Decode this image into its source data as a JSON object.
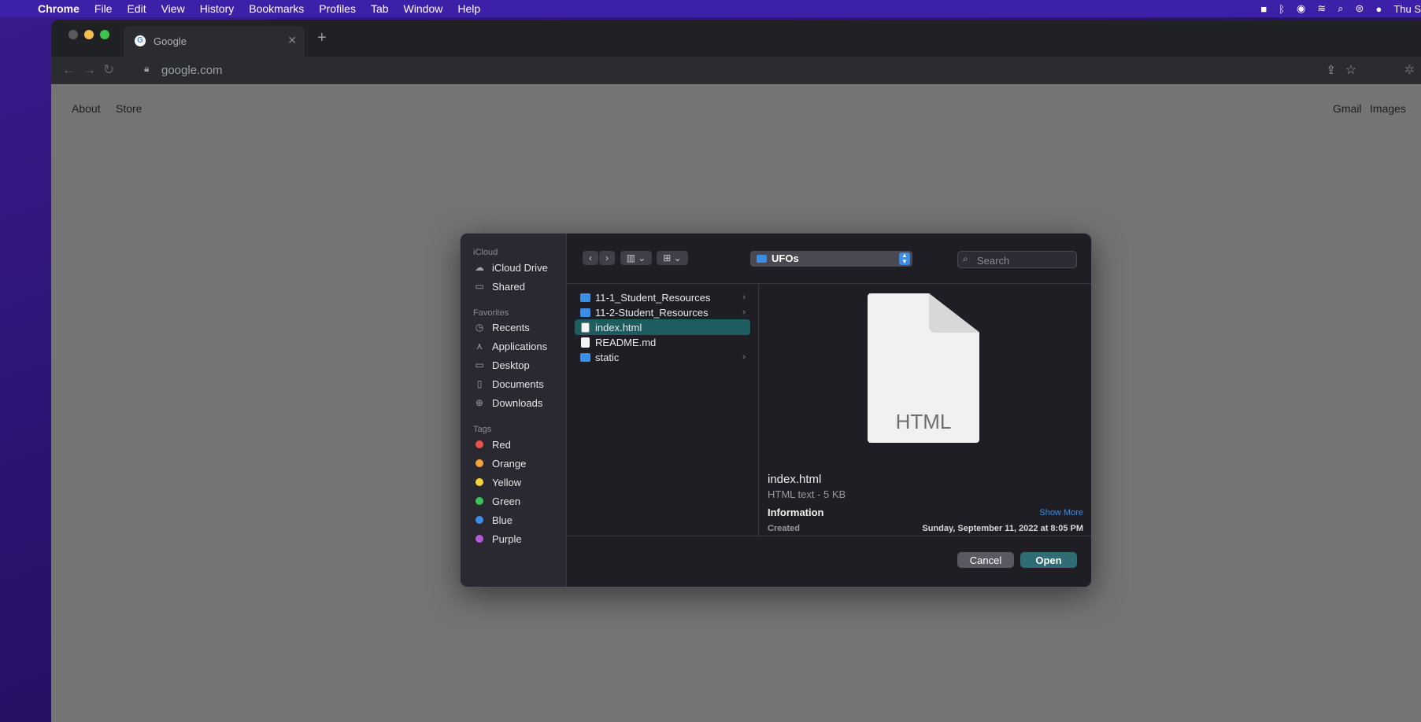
{
  "menubar": {
    "items": [
      "Chrome",
      "File",
      "Edit",
      "View",
      "History",
      "Bookmarks",
      "Profiles",
      "Tab",
      "Window",
      "Help"
    ],
    "clock": "Thu S"
  },
  "browser": {
    "tab_title": "Google",
    "url": "google.com"
  },
  "page": {
    "links_left": [
      "About",
      "Store"
    ],
    "links_right": [
      "Gmail",
      "Images"
    ]
  },
  "dialog": {
    "sidebar": {
      "icloud_head": "iCloud",
      "icloud": [
        "iCloud Drive",
        "Shared"
      ],
      "favorites_head": "Favorites",
      "favorites": [
        "Recents",
        "Applications",
        "Desktop",
        "Documents",
        "Downloads"
      ],
      "tags_head": "Tags",
      "tags": [
        {
          "label": "Red",
          "color": "#e5534b"
        },
        {
          "label": "Orange",
          "color": "#f2a33a"
        },
        {
          "label": "Yellow",
          "color": "#f5d33a"
        },
        {
          "label": "Green",
          "color": "#39c45a"
        },
        {
          "label": "Blue",
          "color": "#3a8ee6"
        },
        {
          "label": "Purple",
          "color": "#b45ad8"
        }
      ]
    },
    "current_folder": "UFOs",
    "search_placeholder": "Search",
    "files": [
      {
        "name": "11-1_Student_Resources",
        "kind": "folder"
      },
      {
        "name": "11-2-Student_Resources",
        "kind": "folder"
      },
      {
        "name": "index.html",
        "kind": "html",
        "selected": true
      },
      {
        "name": "README.md",
        "kind": "doc"
      },
      {
        "name": "static",
        "kind": "folder"
      }
    ],
    "preview": {
      "icon_label": "HTML",
      "name": "index.html",
      "kind": "HTML text - 5 KB",
      "info_head": "Information",
      "show_more": "Show More",
      "created_label": "Created",
      "created_value": "Sunday, September 11, 2022 at 8:05 PM"
    },
    "buttons": {
      "cancel": "Cancel",
      "open": "Open"
    }
  }
}
